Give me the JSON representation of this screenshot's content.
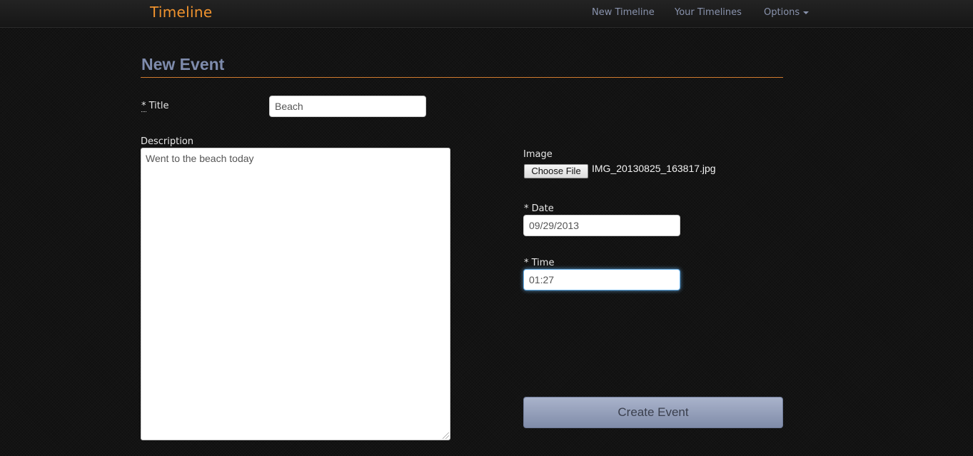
{
  "navbar": {
    "brand": "Timeline",
    "links": [
      {
        "label": "New Timeline"
      },
      {
        "label": "Your Timelines"
      },
      {
        "label": "Options"
      }
    ]
  },
  "page": {
    "title": "New Event"
  },
  "form": {
    "title_label_req": "*",
    "title_label": "Title",
    "title_value": "Beach",
    "description_label": "Description",
    "description_value": "Went to the beach today",
    "image_label": "Image",
    "file_button_label": "Choose File",
    "file_name": "IMG_20130825_163817.jpg",
    "date_label_req": "*",
    "date_label": "Date",
    "date_value": "09/29/2013",
    "time_label_req": "*",
    "time_label": "Time",
    "time_value": "01:27",
    "submit_label": "Create Event"
  },
  "colors": {
    "brand": "#f0932e",
    "nav_link": "#8993ad",
    "heading": "#7e8bac",
    "rule": "#d07a2e",
    "button": "#939fbb"
  }
}
